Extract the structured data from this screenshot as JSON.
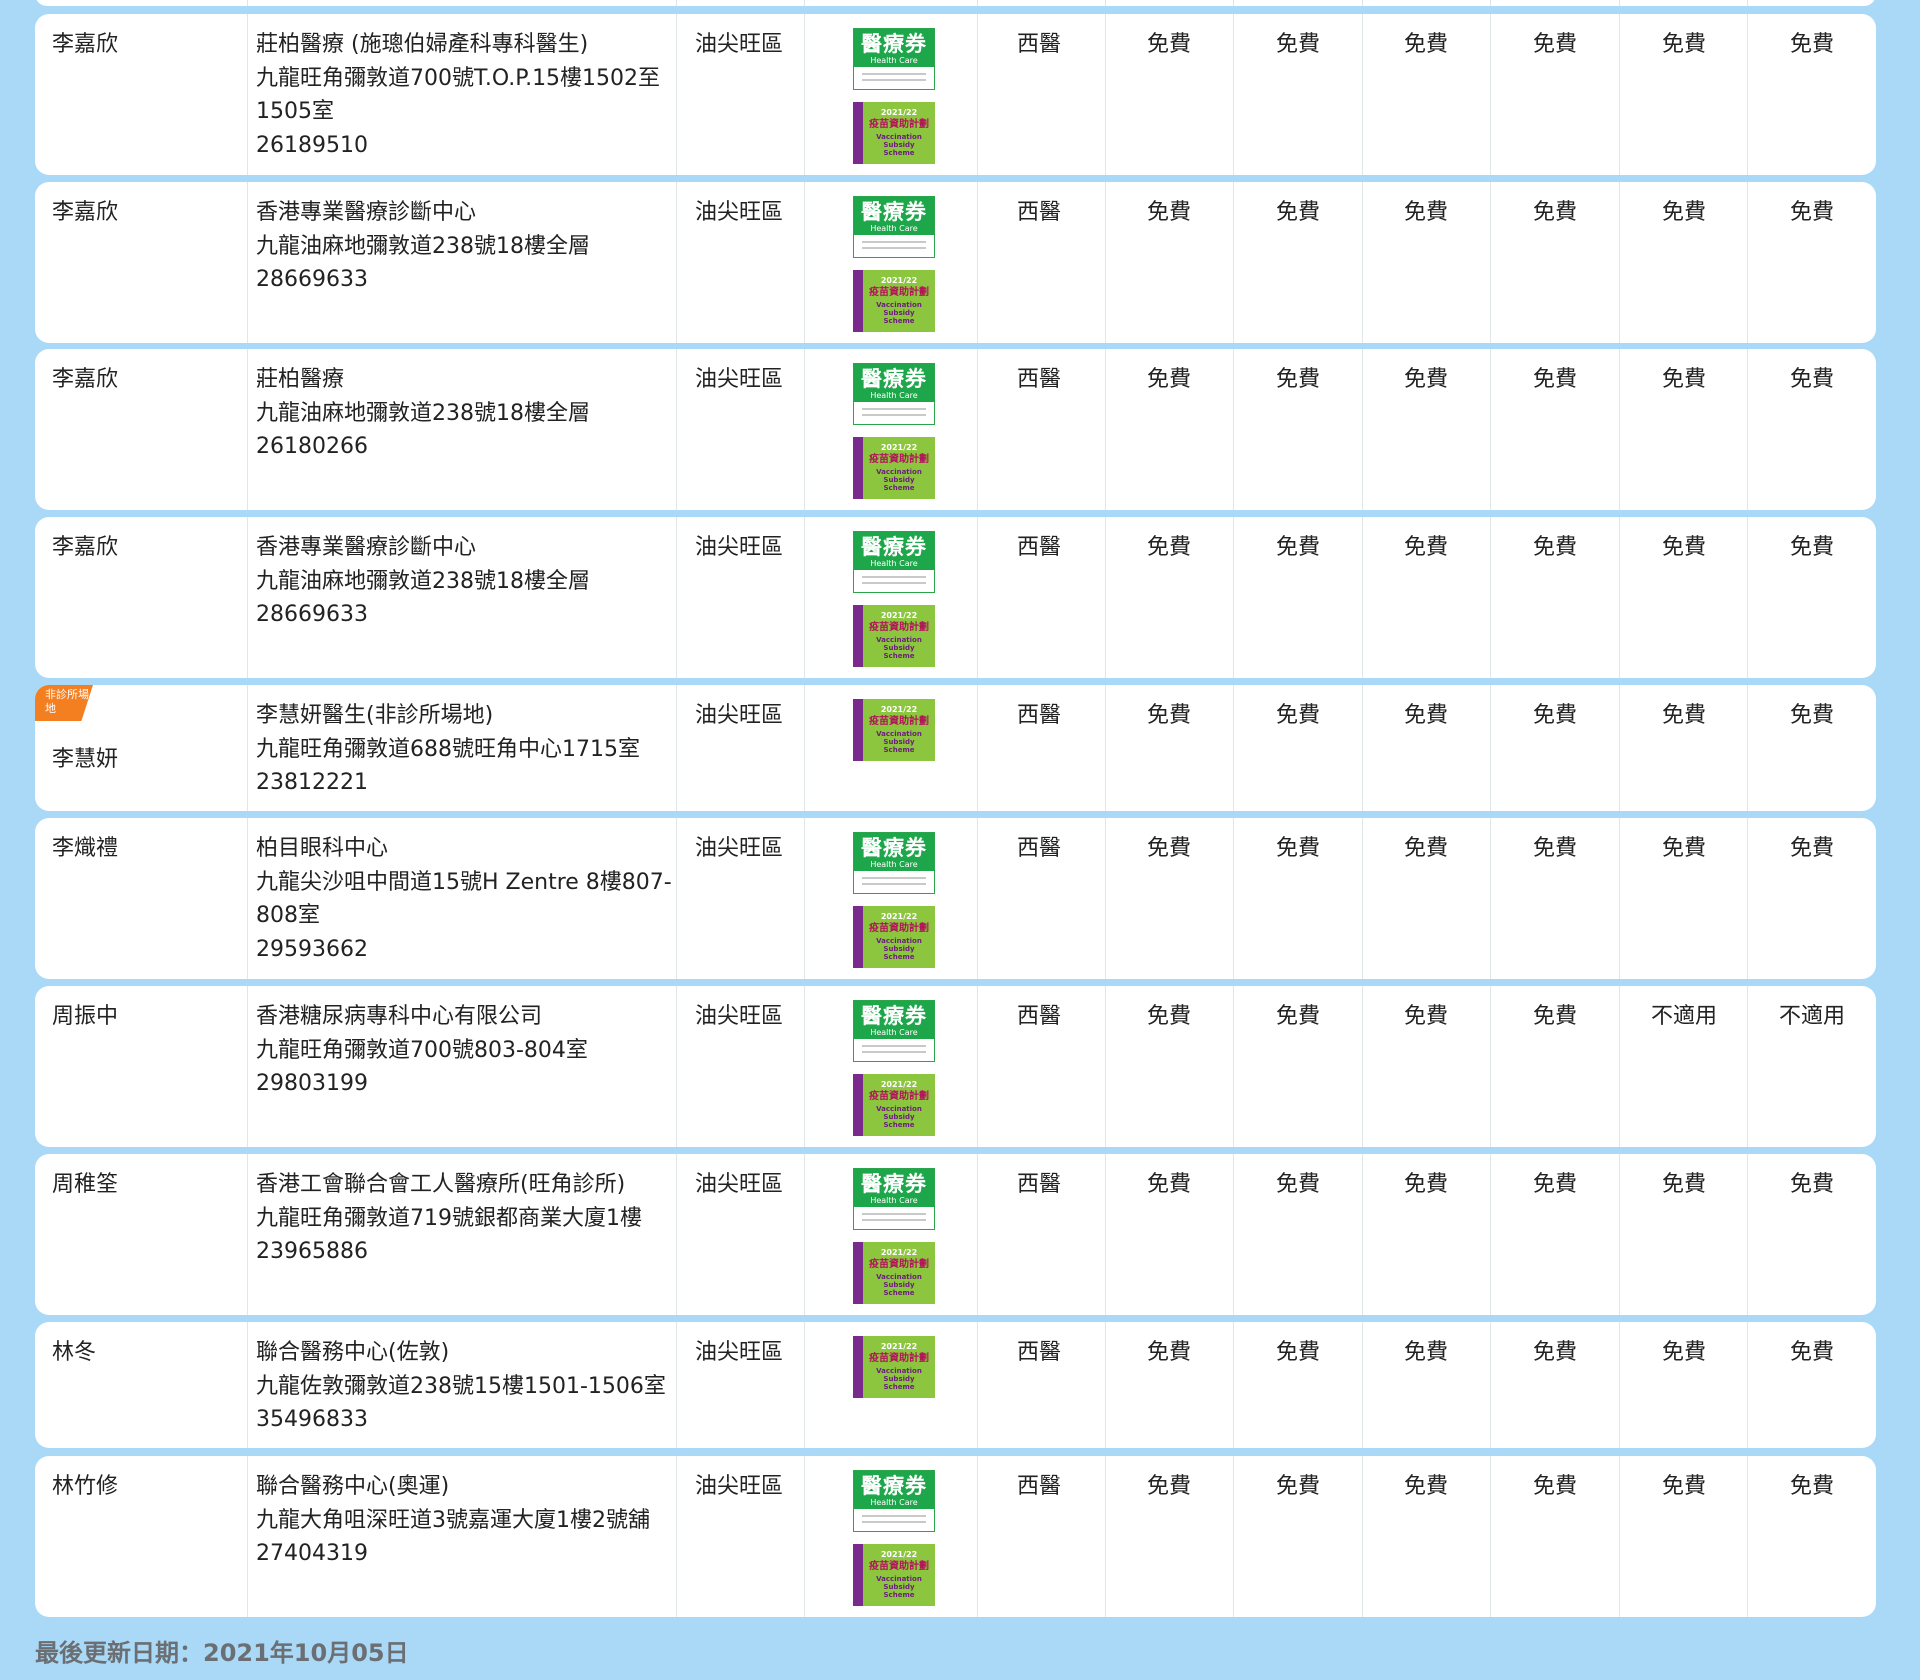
{
  "rows": [
    {
      "name": "李嘉欣",
      "clinic": "莊柏醫療 (施璁伯婦產科專科醫生)",
      "address": "九龍旺角彌敦道700號T.O.P.15樓1502至1505室",
      "phone": "26189510",
      "district": "油尖旺區",
      "badges": [
        "hcv",
        "vss"
      ],
      "type": "西醫",
      "fees": [
        "免費",
        "免費",
        "免費",
        "免費",
        "免費",
        "免費"
      ]
    },
    {
      "name": "李嘉欣",
      "clinic": "香港專業醫療診斷中心",
      "address": "九龍油麻地彌敦道238號18樓全層",
      "phone": "28669633",
      "district": "油尖旺區",
      "badges": [
        "hcv",
        "vss"
      ],
      "type": "西醫",
      "fees": [
        "免費",
        "免費",
        "免費",
        "免費",
        "免費",
        "免費"
      ]
    },
    {
      "name": "李嘉欣",
      "clinic": "莊柏醫療",
      "address": "九龍油麻地彌敦道238號18樓全層",
      "phone": "26180266",
      "district": "油尖旺區",
      "badges": [
        "hcv",
        "vss"
      ],
      "type": "西醫",
      "fees": [
        "免費",
        "免費",
        "免費",
        "免費",
        "免費",
        "免費"
      ]
    },
    {
      "name": "李嘉欣",
      "clinic": "香港專業醫療診斷中心",
      "address": "九龍油麻地彌敦道238號18樓全層",
      "phone": "28669633",
      "district": "油尖旺區",
      "badges": [
        "hcv",
        "vss"
      ],
      "type": "西醫",
      "fees": [
        "免費",
        "免費",
        "免費",
        "免費",
        "免費",
        "免費"
      ]
    },
    {
      "name": "李慧妍",
      "tag": "非診所場地",
      "clinic": "李慧妍醫生(非診所場地)",
      "address": "九龍旺角彌敦道688號旺角中心1715室",
      "phone": "23812221",
      "district": "油尖旺區",
      "badges": [
        "vss"
      ],
      "type": "西醫",
      "fees": [
        "免費",
        "免費",
        "免費",
        "免費",
        "免費",
        "免費"
      ]
    },
    {
      "name": "李熾禮",
      "clinic": "柏目眼科中心",
      "address": "九龍尖沙咀中間道15號H Zentre 8樓807-808室",
      "phone": "29593662",
      "district": "油尖旺區",
      "badges": [
        "hcv",
        "vss"
      ],
      "type": "西醫",
      "fees": [
        "免費",
        "免費",
        "免費",
        "免費",
        "免費",
        "免費"
      ]
    },
    {
      "name": "周振中",
      "clinic": "香港糖尿病專科中心有限公司",
      "address": "九龍旺角彌敦道700號803-804室",
      "phone": "29803199",
      "district": "油尖旺區",
      "badges": [
        "hcv",
        "vss"
      ],
      "type": "西醫",
      "fees": [
        "免費",
        "免費",
        "免費",
        "免費",
        "不適用",
        "不適用"
      ]
    },
    {
      "name": "周稚筌",
      "clinic": "香港工會聯合會工人醫療所(旺角診所)",
      "address": "九龍旺角彌敦道719號銀都商業大廈1樓",
      "phone": "23965886",
      "district": "油尖旺區",
      "badges": [
        "hcv",
        "vss"
      ],
      "type": "西醫",
      "fees": [
        "免費",
        "免費",
        "免費",
        "免費",
        "免費",
        "免費"
      ]
    },
    {
      "name": "林冬",
      "clinic": "聯合醫務中心(佐敦)",
      "address": "九龍佐敦彌敦道238號15樓1501-1506室",
      "phone": "35496833",
      "district": "油尖旺區",
      "badges": [
        "vss"
      ],
      "type": "西醫",
      "fees": [
        "免費",
        "免費",
        "免費",
        "免費",
        "免費",
        "免費"
      ]
    },
    {
      "name": "林竹修",
      "clinic": "聯合醫務中心(奧運)",
      "address": "九龍大角咀深旺道3號嘉運大廈1樓2號舖",
      "phone": "27404319",
      "district": "油尖旺區",
      "badges": [
        "hcv",
        "vss"
      ],
      "type": "西醫",
      "fees": [
        "免費",
        "免費",
        "免費",
        "免費",
        "免費",
        "免費"
      ]
    }
  ],
  "badge_text": {
    "hcv_big": "醫療券",
    "hcv_sub": "Health Care Voucher",
    "vss_year": "2021/22",
    "vss_cn": "疫苗資助計劃",
    "vss_en": "Vaccination Subsidy Scheme"
  },
  "footer": {
    "last_updated": "最後更新日期：2021年10月05日"
  }
}
